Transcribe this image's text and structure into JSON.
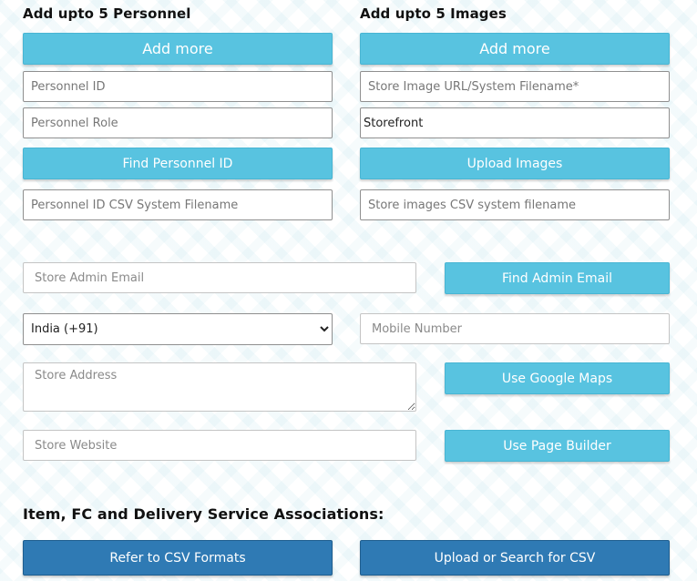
{
  "personnel": {
    "heading": "Add upto 5 Personnel",
    "add_more_label": "Add more",
    "id_placeholder": "Personnel ID",
    "role_placeholder": "Personnel Role",
    "find_button_label": "Find Personnel ID",
    "csv_placeholder": "Personnel ID CSV System Filename"
  },
  "images": {
    "heading": "Add upto 5 Images",
    "add_more_label": "Add more",
    "url_placeholder": "Store Image URL/System Filename*",
    "image_value": "Storefront",
    "upload_button_label": "Upload Images",
    "csv_placeholder": "Store images CSV system filename"
  },
  "store": {
    "admin_email_placeholder": "Store Admin Email",
    "find_admin_label": "Find Admin Email",
    "country_options": [
      "India (+91)"
    ],
    "country_selected": "India (+91)",
    "mobile_placeholder": "Mobile Number",
    "address_placeholder": "Store Address",
    "google_maps_label": "Use Google Maps",
    "website_placeholder": "Store Website",
    "page_builder_label": "Use Page Builder"
  },
  "associations": {
    "heading": "Item, FC and Delivery Service Associations:",
    "csv_formats_label": "Refer to CSV Formats",
    "upload_search_label": "Upload or Search for CSV"
  },
  "colors": {
    "button_light": "#58c3e0",
    "button_dark": "#2f7ab4",
    "field_border": "#c4c4c4"
  }
}
